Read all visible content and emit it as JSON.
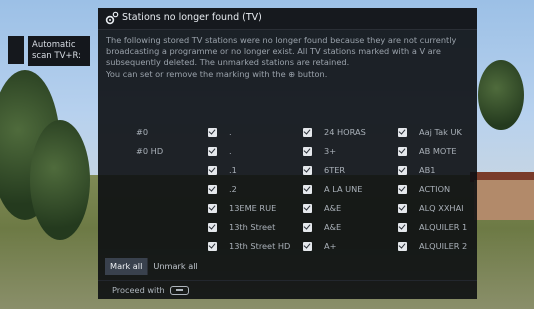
{
  "side_panel": {
    "label_line1": "Automatic",
    "label_line2": "scan TV+R:"
  },
  "dialog": {
    "title": "Stations no longer found (TV)",
    "description": [
      "The following stored TV stations were no longer found because they are not currently",
      "broadcasting a programme or no longer exist. All TV stations marked with a V are",
      "subsequently deleted. The unmarked stations are retained.",
      "You can set or remove the marking with the ⊕ button."
    ],
    "columns": [
      {
        "prefixes": [
          "#0",
          "#0 HD"
        ],
        "items": [
          ".",
          ".",
          ".1",
          ".2",
          "13EME RUE",
          "13th Street",
          "13th Street HD"
        ]
      },
      {
        "items": [
          "24 HORAS",
          "3+",
          "6TER",
          "A LA UNE",
          "A&E",
          "A&E",
          "A+"
        ]
      },
      {
        "items": [
          "Aaj Tak UK",
          "AB MOTE",
          "AB1",
          "ACTION",
          "ALQ XXHAI",
          "ALQUILER 1",
          "ALQUILER 2"
        ]
      }
    ],
    "buttons": {
      "mark_all": "Mark all",
      "unmark_all": "Unmark all"
    },
    "footer": {
      "proceed": "Proceed with"
    }
  },
  "colors": {
    "dialog_bg": "#0c0e12",
    "selected_button": "#39414d",
    "checkbox": "#e5e8ec"
  },
  "icons": {
    "title_icon": "gear-icon",
    "ok_key_icon": "ok-button-icon"
  }
}
